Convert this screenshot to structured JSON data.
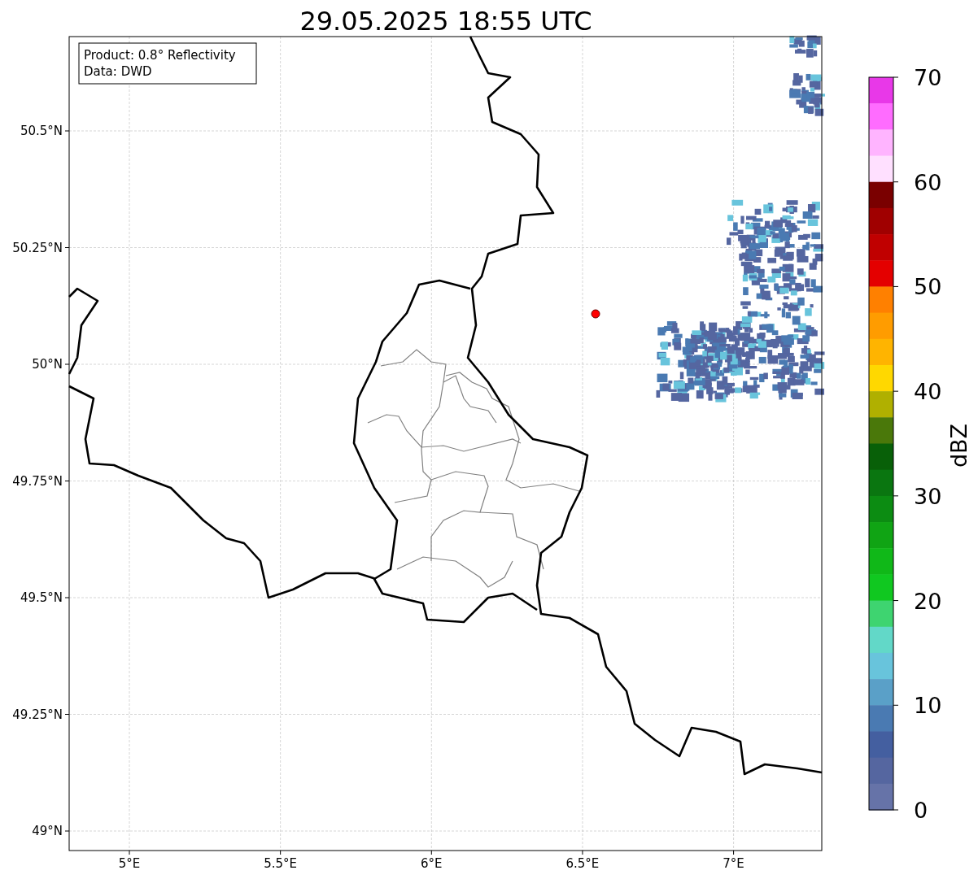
{
  "title": "29.05.2025 18:55 UTC",
  "legend": [
    "Product: 0.8° Reflectivity",
    "Data: DWD"
  ],
  "x_ticks": [
    "5°E",
    "5.5°E",
    "6°E",
    "6.5°E",
    "7°E"
  ],
  "y_ticks": [
    "50.5°N",
    "50.25°N",
    "50°N",
    "49.75°N",
    "49.5°N",
    "49.25°N",
    "49°N"
  ],
  "colorbar": {
    "label": "dBZ",
    "bands": [
      {
        "color": "#e838e8"
      },
      {
        "color": "#ff6cff"
      },
      {
        "color": "#ffb4ff"
      },
      {
        "color": "#ffe0ff"
      },
      {
        "color": "#7a0000"
      },
      {
        "color": "#a00000"
      },
      {
        "color": "#c00000"
      },
      {
        "color": "#e40000"
      },
      {
        "color": "#ff8000"
      },
      {
        "color": "#ff9c00"
      },
      {
        "color": "#ffb400"
      },
      {
        "color": "#ffd800"
      },
      {
        "color": "#b0b000"
      },
      {
        "color": "#4a780a"
      },
      {
        "color": "#086008"
      },
      {
        "color": "#0a7610"
      },
      {
        "color": "#0c8c12"
      },
      {
        "color": "#10a414"
      },
      {
        "color": "#10b818"
      },
      {
        "color": "#10c820"
      },
      {
        "color": "#3ed470"
      },
      {
        "color": "#62d8c8"
      },
      {
        "color": "#68c4dc"
      },
      {
        "color": "#5aa0c8"
      },
      {
        "color": "#4a7ab2"
      },
      {
        "color": "#445fa0"
      },
      {
        "color": "#5566a0"
      },
      {
        "color": "#6673a8"
      }
    ],
    "ticks": [
      "70",
      "60",
      "50",
      "40",
      "30",
      "20",
      "10",
      "0"
    ]
  }
}
